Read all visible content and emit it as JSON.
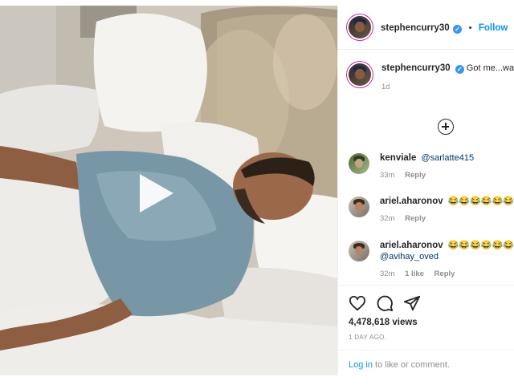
{
  "post": {
    "username": "stephencurry30",
    "verified_mark": "✓",
    "separator": "•",
    "follow_label": "Follow",
    "caption_text": "Got me...waking up thinking I'm in Orlando 🤦🏽‍♂️🏝😂",
    "time": "1d",
    "views": "4,478,618 views",
    "date": "1 DAY AGO.",
    "login_link": "Log in",
    "login_suffix": " to like or comment."
  },
  "comments": [
    {
      "username": "kenviale",
      "text": "@sarlatte415",
      "time": "33m",
      "likes": "",
      "reply": "Reply"
    },
    {
      "username": "ariel.aharonov",
      "text": "😂😂😂😂😂😂😂😂😂",
      "time": "32m",
      "likes": "",
      "reply": "Reply"
    },
    {
      "username": "ariel.aharonov",
      "text": "😂😂😂😂😂😂",
      "text_line2": "@avihay_oved",
      "time": "32m",
      "likes": "1 like",
      "reply": "Reply"
    }
  ],
  "icons": {
    "play": "play-icon",
    "add_comment": "plus-circle-icon",
    "like": "heart-icon",
    "comment": "comment-icon",
    "share": "share-icon"
  },
  "colors": {
    "accent": "#0095f6",
    "verified": "#3897f0",
    "muted": "#8e8e8e",
    "text": "#262626"
  }
}
